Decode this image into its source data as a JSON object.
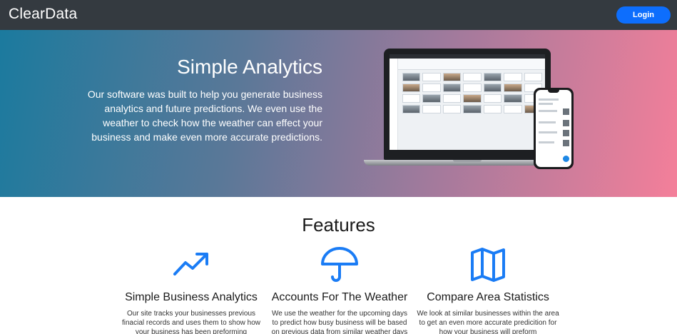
{
  "navbar": {
    "brand": "ClearData",
    "login_label": "Login"
  },
  "hero": {
    "title": "Simple Analytics",
    "text": "Our software was built to help you generate business analytics and future predictions. We even use the weather to check how the weather can effect your business and make even more accurate predictions."
  },
  "features": {
    "title": "Features",
    "items": [
      {
        "icon": "trending-up-icon",
        "title": "Simple Business Analytics",
        "text": "Our site tracks your businesses previous finacial records and uses them to show how your business has been preforming"
      },
      {
        "icon": "umbrella-icon",
        "title": "Accounts For The Weather",
        "text": "We use the weather for the upcoming days to predict how busy business will be based on previous data from similar weather days"
      },
      {
        "icon": "map-icon",
        "title": "Compare Area Statistics",
        "text": "We look at similar businesses within the area to get an even more accurate predicition for how your business will preform"
      }
    ]
  },
  "colors": {
    "navbar": "#343a40",
    "accent": "#0d6efd",
    "icon": "#1a7cf5",
    "hero_start": "#1b7a9e",
    "hero_end": "#f47f9a"
  }
}
